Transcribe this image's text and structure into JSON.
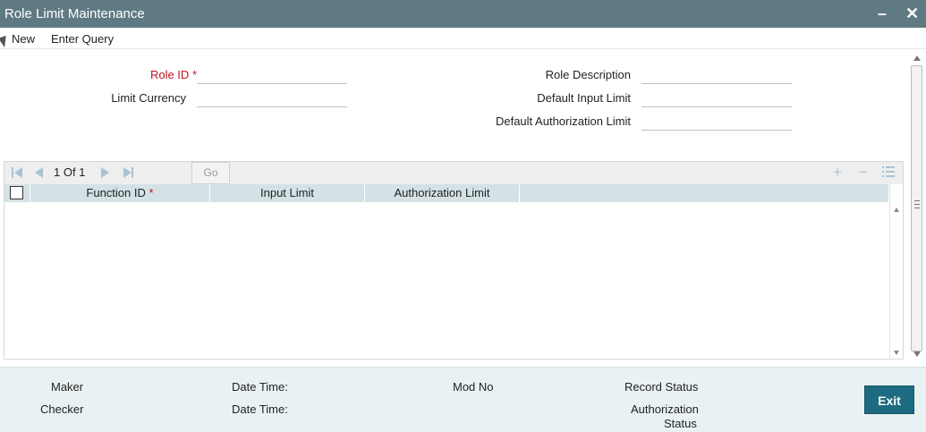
{
  "window": {
    "title": "Role Limit Maintenance",
    "minimize_glyph": "–",
    "close_glyph": "✕"
  },
  "menu": {
    "new_label": "New",
    "enter_query_label": "Enter Query"
  },
  "form": {
    "role_id_label": "Role ID",
    "required_marker": "*",
    "role_id_value": "",
    "limit_currency_label": "Limit Currency",
    "limit_currency_value": "",
    "role_description_label": "Role Description",
    "role_description_value": "",
    "default_input_limit_label": "Default Input Limit",
    "default_input_limit_value": "",
    "default_authorization_limit_label": "Default Authorization Limit",
    "default_authorization_limit_value": ""
  },
  "grid": {
    "page_info": "1 Of 1",
    "go_label": "Go",
    "add_glyph": "+",
    "remove_glyph": "−",
    "columns": [
      "Function ID",
      "Input Limit",
      "Authorization Limit"
    ],
    "required_marker": "*",
    "rows": []
  },
  "footer": {
    "maker_label": "Maker",
    "checker_label": "Checker",
    "date_time_label_1": "Date Time:",
    "date_time_label_2": "Date Time:",
    "mod_no_label": "Mod No",
    "record_status_label": "Record Status",
    "authorization_status_label_line1": "Authorization",
    "authorization_status_label_line2": "Status",
    "exit_label": "Exit"
  },
  "colors": {
    "titlebar": "#5f7a82",
    "required": "#c0121d",
    "grid_header": "#d5e2e5",
    "footer_bg": "#e9f2f2",
    "exit_button": "#1d6b80"
  }
}
